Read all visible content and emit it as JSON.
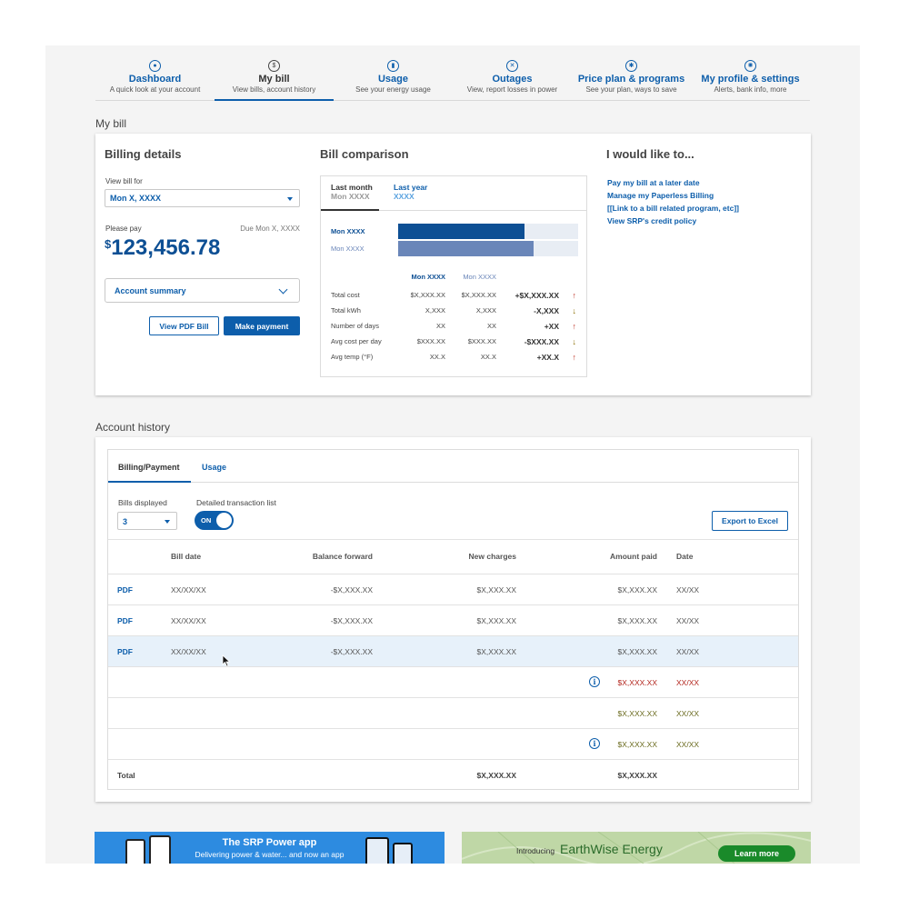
{
  "nav": {
    "items": [
      {
        "title": "Dashboard",
        "sub": "A quick look at your account",
        "icon": "person-icon",
        "glyph": "●"
      },
      {
        "title": "My bill",
        "sub": "View bills, account history",
        "icon": "dollar-icon",
        "glyph": "$"
      },
      {
        "title": "Usage",
        "sub": "See your energy usage",
        "icon": "chart-icon",
        "glyph": "▮"
      },
      {
        "title": "Outages",
        "sub": "View, report losses in power",
        "icon": "outage-icon",
        "glyph": "✕"
      },
      {
        "title": "Price plan & programs",
        "sub": "See your plan, ways to save",
        "icon": "sun-icon",
        "glyph": "✱"
      },
      {
        "title": "My profile & settings",
        "sub": "Alerts, bank info, more",
        "icon": "gear-icon",
        "glyph": "✺"
      }
    ],
    "active": "My bill"
  },
  "my_bill": {
    "section_title": "My bill",
    "billing": {
      "heading": "Billing details",
      "view_bill_for_label": "View bill for",
      "view_bill_for_value": "Mon X, XXXX",
      "please_pay_label": "Please pay",
      "due_label": "Due Mon X, XXXX",
      "currency": "$",
      "amount": "123,456.78",
      "account_summary": "Account summary",
      "view_pdf_button": "View PDF Bill",
      "make_payment_button": "Make payment"
    },
    "comparison": {
      "heading": "Bill comparison",
      "tabs": [
        {
          "title": "Last month",
          "sub": "Mon XXXX"
        },
        {
          "title": "Last year",
          "sub": "XXXX"
        }
      ],
      "bars": [
        {
          "label": "Mon XXXX",
          "value": 0.7,
          "color": "#0d4f94"
        },
        {
          "label": "Mon XXXX",
          "value": 0.75,
          "color": "#6a86b9"
        }
      ],
      "col_a": "Mon XXXX",
      "col_b": "Mon XXXX",
      "rows": [
        {
          "label": "Total cost",
          "a": "$X,XXX.XX",
          "b": "$X,XXX.XX",
          "diff": "+$X,XXX.XX",
          "arrow": "↑"
        },
        {
          "label": "Total kWh",
          "a": "X,XXX",
          "b": "X,XXX",
          "diff": "-X,XXX",
          "arrow": "↓"
        },
        {
          "label": "Number of days",
          "a": "XX",
          "b": "XX",
          "diff": "+XX",
          "arrow": "↑"
        },
        {
          "label": "Avg cost per day",
          "a": "$XXX.XX",
          "b": "$XXX.XX",
          "diff": "-$XXX.XX",
          "arrow": "↓"
        },
        {
          "label": "Avg temp (°F)",
          "a": "XX.X",
          "b": "XX.X",
          "diff": "+XX.X",
          "arrow": "↑"
        }
      ]
    },
    "actions": {
      "heading": "I would like to...",
      "links": [
        "Pay my bill at a later date",
        "Manage my Paperless Billing",
        "[[Link to a bill related program, etc]]",
        "View SRP's credit policy"
      ]
    }
  },
  "account_history": {
    "section_title": "Account history",
    "tabs": [
      "Billing/Payment",
      "Usage"
    ],
    "bills_displayed_label": "Bills displayed",
    "bills_displayed_value": "3",
    "detailed_list_label": "Detailed transaction list",
    "toggle_label": "ON",
    "export_button": "Export to Excel",
    "columns": [
      "Bill date",
      "Balance forward",
      "New charges",
      "Amount paid",
      "Date"
    ],
    "rows": [
      {
        "pdf": "PDF",
        "bill_date": "XX/XX/XX",
        "balance": "-$X,XXX.XX",
        "charges": "$X,XXX.XX",
        "paid": "$X,XXX.XX",
        "date": "XX/XX",
        "style": "normal",
        "info": false
      },
      {
        "pdf": "PDF",
        "bill_date": "XX/XX/XX",
        "balance": "-$X,XXX.XX",
        "charges": "$X,XXX.XX",
        "paid": "$X,XXX.XX",
        "date": "XX/XX",
        "style": "normal",
        "info": false
      },
      {
        "pdf": "PDF",
        "bill_date": "XX/XX/XX",
        "balance": "-$X,XXX.XX",
        "charges": "$X,XXX.XX",
        "paid": "$X,XXX.XX",
        "date": "XX/XX",
        "style": "normal",
        "info": false
      },
      {
        "pdf": "",
        "bill_date": "",
        "balance": "",
        "charges": "",
        "paid": "$X,XXX.XX",
        "date": "XX/XX",
        "style": "red",
        "info": true
      },
      {
        "pdf": "",
        "bill_date": "",
        "balance": "",
        "charges": "",
        "paid": "$X,XXX.XX",
        "date": "XX/XX",
        "style": "olive",
        "info": false
      },
      {
        "pdf": "",
        "bill_date": "",
        "balance": "",
        "charges": "",
        "paid": "$X,XXX.XX",
        "date": "XX/XX",
        "style": "olive",
        "info": true
      }
    ],
    "total_label": "Total",
    "total_charges": "$X,XXX.XX",
    "total_paid": "$X,XXX.XX"
  },
  "banners": {
    "app_title": "The SRP Power app",
    "app_sub": "Delivering power & water... and now an app",
    "earth_intro": "Introducing",
    "earth_title": "EarthWise Energy",
    "earth_button": "Learn more"
  },
  "colors": {
    "brand_blue": "#0d5eab",
    "red_text": "#b3261e",
    "olive_text": "#6b6b1f",
    "highlight_row": "#e7f1fa"
  }
}
